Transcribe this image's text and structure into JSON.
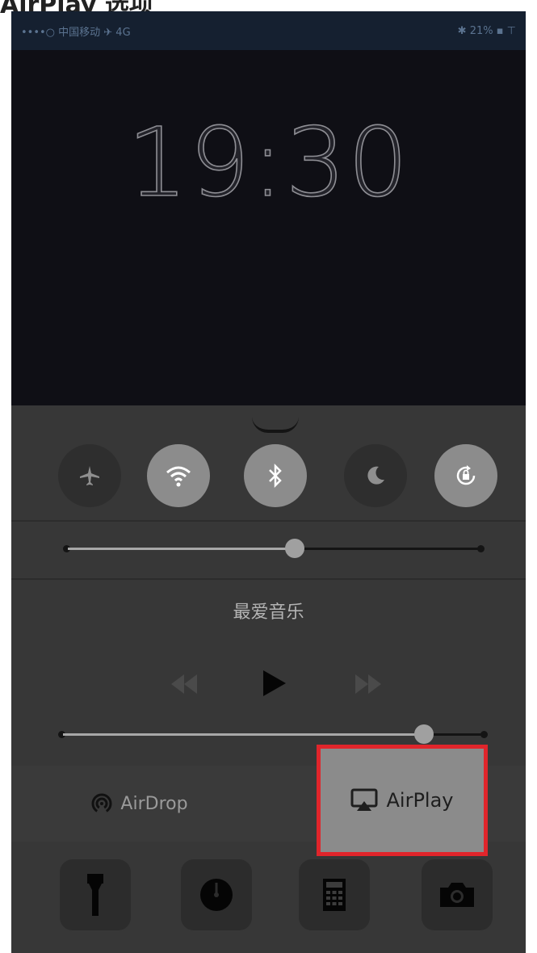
{
  "caption": "AirPlay 选项",
  "status_bar": {
    "left": "••••○ 中国移动 ✈ 4G",
    "right": "✱ 21% ▪ ⊤"
  },
  "lockscreen": {
    "time": "19:30"
  },
  "control_center": {
    "toggles": [
      {
        "name": "airplane-mode",
        "icon": "airplane-icon",
        "state": "off"
      },
      {
        "name": "wifi",
        "icon": "wifi-icon",
        "state": "on"
      },
      {
        "name": "bluetooth",
        "icon": "bluetooth-icon",
        "state": "on"
      },
      {
        "name": "do-not-disturb",
        "icon": "moon-icon",
        "state": "off"
      },
      {
        "name": "rotation-lock",
        "icon": "rotation-lock-icon",
        "state": "on"
      }
    ],
    "brightness_level": 0.55,
    "music": {
      "title": "最爱音乐",
      "controls": [
        "rewind-icon",
        "play-icon",
        "fast-forward-icon"
      ],
      "volume_level": 0.86
    },
    "buttons": {
      "airdrop_label": "AirDrop",
      "airplay_label": "AirPlay"
    },
    "shortcuts": [
      "flashlight-icon",
      "timer-icon",
      "calculator-icon",
      "camera-icon"
    ],
    "colors": {
      "highlight_border": "#e0252b"
    }
  }
}
